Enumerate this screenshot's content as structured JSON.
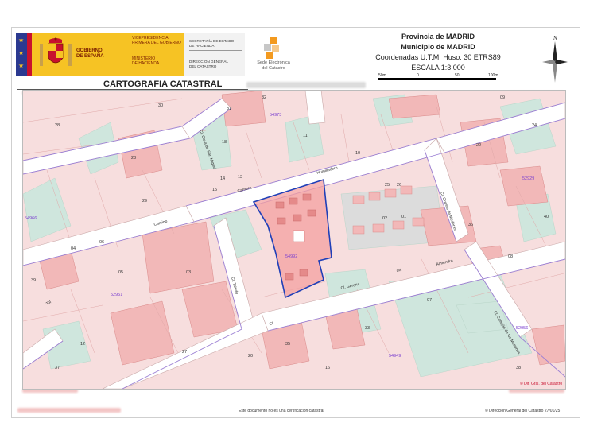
{
  "header": {
    "gov_line1": "GOBIERNO",
    "gov_line2": "DE ESPAÑA",
    "vice_line1": "VICEPRESIDENCIA",
    "vice_line2": "PRIMERA DEL GOBIERNO",
    "minis_line1": "MINISTERIO",
    "minis_line2": "DE HACIENDA",
    "secretaria_line1": "SECRETARÍA DE ESTADO",
    "secretaria_line2": "DE HACIENDA",
    "direccion_line1": "DIRECCIÓN GENERAL",
    "direccion_line2": "DEL CATASTRO",
    "sede_line1": "Sede Electrónica",
    "sede_line2": "del Catastro",
    "cartografia_title": "CARTOGRAFIA CATASTRAL"
  },
  "info": {
    "provincia": "Provincia de MADRID",
    "municipio": "Municipio de MADRID",
    "coordenadas": "Coordenadas U.T.M. Huso: 30 ETRS89",
    "escala": "ESCALA 1:3,000",
    "scale_ticks": [
      "50m",
      "0",
      "50",
      "100m"
    ]
  },
  "north_label": "N",
  "map": {
    "polygon_labels": [
      "54973",
      "52951",
      "54949",
      "54992",
      "52929",
      "52956",
      "54966"
    ],
    "street_labels": [
      "Carrtera",
      "Humilladero",
      "Cl. Cava de San Miguel",
      "Camino",
      "Cl. Toledo",
      "Cl. Gerona",
      "Cl.",
      "del",
      "Cl. Cuesta de Mederas",
      "Cl. Callejón de los Mesones",
      "Almendro",
      "Tol"
    ],
    "parcel_numbers": [
      "31",
      "13",
      "14",
      "15",
      "11",
      "18",
      "23",
      "01",
      "02",
      "03",
      "04",
      "05",
      "06",
      "07",
      "08",
      "09",
      "10",
      "12",
      "16",
      "20",
      "22",
      "24",
      "25",
      "26",
      "27",
      "28",
      "29",
      "30",
      "32",
      "33",
      "35",
      "36",
      "37",
      "38",
      "39",
      "40"
    ],
    "copyright_mark": "© Dir. Gral. del Catastro"
  },
  "footer": {
    "note": "Este documento no es una certificación catastral",
    "copyright": "© Dirección General del Catastro 27/01/25"
  },
  "colors": {
    "gov_yellow": "#f6c324",
    "flag_blue": "#2b3990",
    "flag_red": "#c8102e",
    "parcel_pink": "#f7dede",
    "building_pink": "#f2b8b8",
    "green_space": "#cfe6dd",
    "street_white": "#ffffff",
    "boundary_purple": "#9b7fd4",
    "selection_blue": "#1f3fb8",
    "selection_fill": "#f4a0a0"
  },
  "icons": {
    "gov_shield": "coat-of-arms-icon",
    "sede_logo": "sede-cubes-icon",
    "north_arrow": "compass-rose-icon"
  }
}
